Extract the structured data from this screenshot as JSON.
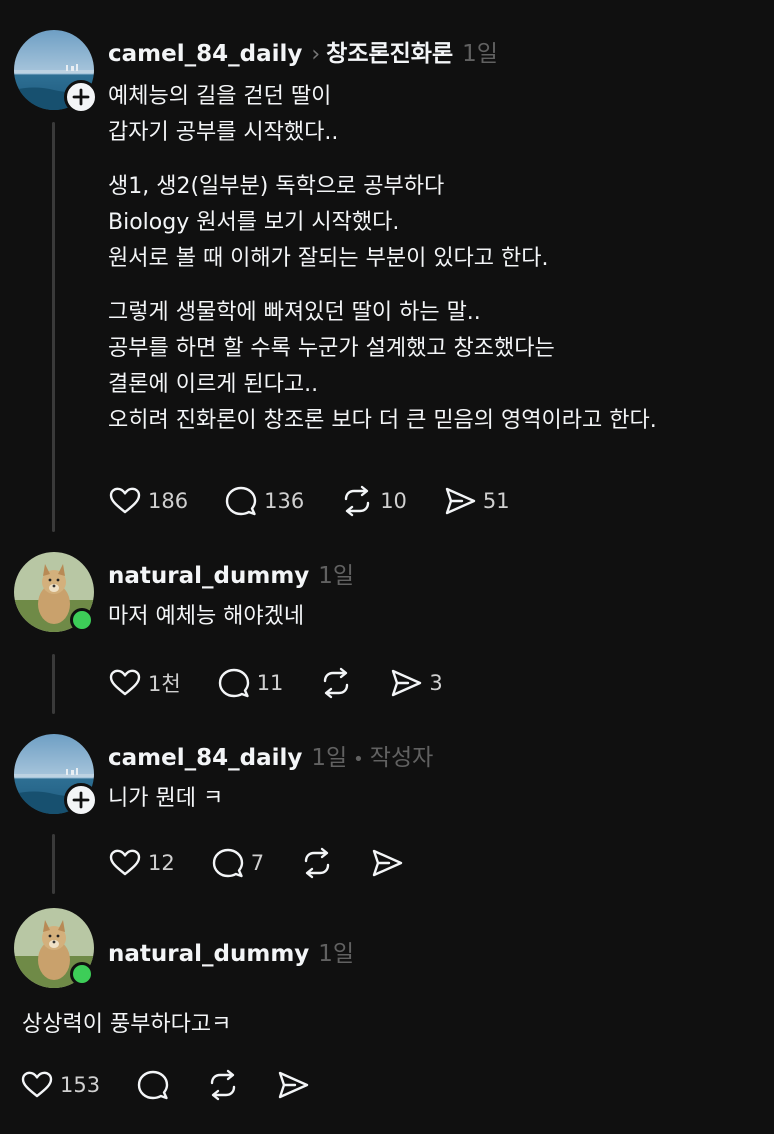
{
  "posts": [
    {
      "username": "camel_84_daily",
      "topic": "창조론진화론",
      "time": "1일",
      "lines": [
        "예체능의 길을 걷던 딸이",
        "갑자기 공부를 시작했다.."
      ],
      "lines2": [
        "생1, 생2(일부분) 독학으로 공부하다",
        "Biology 원서를 보기 시작했다.",
        "원서로 볼 때 이해가 잘되는 부분이 있다고 한다."
      ],
      "lines3": [
        "그렇게 생물학에 빠져있던 딸이 하는 말..",
        "공부를 하면 할 수록 누군가 설계했고 창조했다는",
        "결론에 이르게 된다고..",
        "오히려 진화론이 창조론 보다 더 큰 믿음의 영역이라고 한다."
      ],
      "likes": "186",
      "comments": "136",
      "reposts": "10",
      "shares": "51"
    },
    {
      "username": "natural_dummy",
      "time": "1일",
      "lines": [
        "마저 예체능 해야겠네"
      ],
      "likes": "1천",
      "comments": "11",
      "reposts": "",
      "shares": "3"
    },
    {
      "username": "camel_84_daily",
      "time": "1일",
      "separator": "•",
      "author_label": "작성자",
      "lines": [
        "니가 뭔데 ㅋ"
      ],
      "likes": "12",
      "comments": "7",
      "reposts": "",
      "shares": ""
    },
    {
      "username": "natural_dummy",
      "time": "1일",
      "lines": [
        "상상력이 풍부하다고ㅋ"
      ],
      "likes": "153",
      "comments": "",
      "reposts": "",
      "shares": ""
    }
  ],
  "icons": {
    "like": "heart-icon",
    "comment": "comment-bubble-icon",
    "repost": "repost-icon",
    "share": "send-icon",
    "follow": "plus-icon"
  },
  "colors": {
    "background": "#101010",
    "text": "#f3f5f7",
    "muted": "#616161",
    "online": "#3dcd58"
  }
}
